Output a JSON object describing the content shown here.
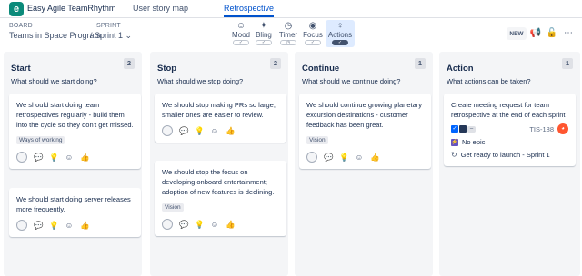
{
  "app": {
    "name": "Easy Agile TeamRhythm",
    "logo_letter": "e"
  },
  "nav": {
    "tabs": [
      {
        "label": "User story map"
      },
      {
        "label": "Retrospective"
      }
    ]
  },
  "toolbar": {
    "board_label": "BOARD",
    "board_value": "Teams in Space Program",
    "sprint_label": "SPRINT",
    "sprint_value": "Sprint 1",
    "tools": [
      {
        "label": "Mood",
        "icon": "smiley-icon"
      },
      {
        "label": "Bling",
        "icon": "sparkle-icon"
      },
      {
        "label": "Timer",
        "icon": "clock-icon"
      },
      {
        "label": "Focus",
        "icon": "eye-icon"
      },
      {
        "label": "Actions",
        "icon": "lightbulb-icon"
      }
    ],
    "new_label": "NEW",
    "accent": "#0052cc"
  },
  "columns": [
    {
      "title": "Start",
      "count": "2",
      "question": "What should we start doing?",
      "cards": [
        {
          "text": "We should start doing team retrospectives regularly - build them into the cycle so they don't get missed.",
          "tag": "Ways of working"
        },
        {
          "text": "We should start doing server releases more frequently.",
          "tag": ""
        }
      ]
    },
    {
      "title": "Stop",
      "count": "2",
      "question": "What should we stop doing?",
      "cards": [
        {
          "text": "We should stop making PRs so large; smaller ones are easier to review.",
          "tag": ""
        },
        {
          "text": "We should stop the focus on developing onboard entertainment; adoption of new features is declining.",
          "tag": "Vision"
        }
      ]
    },
    {
      "title": "Continue",
      "count": "1",
      "question": "What should we continue doing?",
      "cards": [
        {
          "text": "We should continue growing planetary excursion destinations - customer feedback has been great.",
          "tag": "Vision"
        }
      ]
    },
    {
      "title": "Action",
      "count": "1",
      "question": "What actions can be taken?",
      "cards": [
        {
          "text": "Create meeting request for team retrospective at the end of each sprint",
          "issue_key": "TIS-188",
          "epic": "No epic",
          "sprint": "Get ready to launch - Sprint 1"
        }
      ]
    }
  ]
}
